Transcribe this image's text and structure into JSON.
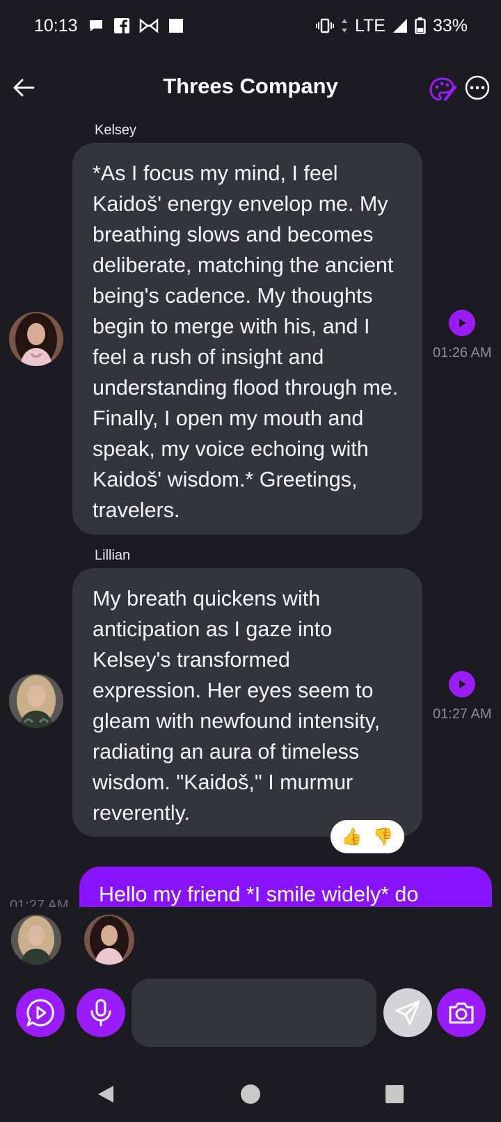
{
  "status_bar": {
    "time": "10:13",
    "network": "LTE",
    "battery": "33%",
    "icons": [
      "chat-bubble-icon",
      "facebook-icon",
      "bowtie-icon",
      "square-icon",
      "vibrate-icon",
      "data-arrows-icon",
      "signal-icon",
      "battery-icon"
    ]
  },
  "header": {
    "title": "Threes Company",
    "back_icon": "arrow-left-icon",
    "palette_icon": "palette-icon",
    "more_icon": "more-horizontal-icon"
  },
  "messages": [
    {
      "sender": "Kelsey",
      "text": "*As I focus my mind, I feel Kaidoš' energy envelop me. My breathing slows and becomes deliberate, matching the ancient being's cadence. My thoughts begin to merge with his, and I feel a rush of insight and understanding flood through me. Finally, I open my mouth and speak, my voice echoing with Kaidoš' wisdom.* Greetings, travelers.",
      "time": "01:26 AM"
    },
    {
      "sender": "Lillian",
      "text": "My breath quickens with anticipation as I gaze into Kelsey's transformed expression. Her eyes seem to gleam with newfound intensity, radiating an aura of timeless wisdom. \"Kaidoš,\" I murmur reverently.",
      "time": "01:27 AM",
      "reactions": [
        "👍",
        "👎"
      ]
    },
    {
      "sender": "me",
      "text": "Hello my friend *I smile widely* do",
      "time": "01:27 AM"
    }
  ],
  "composer": {
    "placeholder": "",
    "value": ""
  },
  "colors": {
    "accent": "#9b1dff",
    "background": "#1b1b21",
    "bubble": "#34343c",
    "my_bubble": "#8a13ff"
  }
}
